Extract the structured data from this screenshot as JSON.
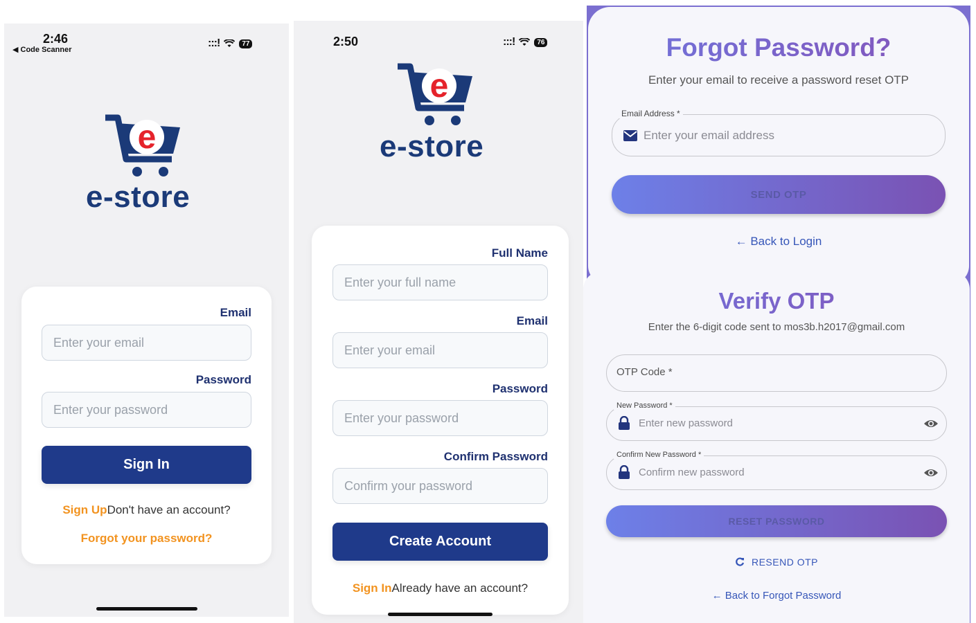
{
  "login_screen": {
    "status": {
      "time": "2:46",
      "back_app": "◀ Code Scanner",
      "signal": ":::!",
      "battery": "77"
    },
    "logo": {
      "letter": "e",
      "text": "e-store"
    },
    "email_label": "Email",
    "email_placeholder": "Enter your email",
    "password_label": "Password",
    "password_placeholder": "Enter your password",
    "sign_in_button": "Sign In",
    "signup_link": "Sign Up",
    "signup_text": "Don't have an account?",
    "forgot_link": "Forgot your password?"
  },
  "register_screen": {
    "status": {
      "time": "2:50",
      "signal": ":::!",
      "battery": "76"
    },
    "logo": {
      "letter": "e",
      "text": "e-store"
    },
    "fullname_label": "Full Name",
    "fullname_placeholder": "Enter your full name",
    "email_label": "Email",
    "email_placeholder": "Enter your email",
    "password_label": "Password",
    "password_placeholder": "Enter your password",
    "confirm_label": "Confirm Password",
    "confirm_placeholder": "Confirm your password",
    "create_button": "Create Account",
    "signin_link": "Sign In",
    "signin_text": "Already have an account?"
  },
  "forgot_panel": {
    "title": "Forgot Password?",
    "subtitle": "Enter your email to receive a password reset OTP",
    "email_legend": "Email Address *",
    "email_placeholder": "Enter your email address",
    "send_button": "SEND OTP",
    "back_link": "← Back to Login"
  },
  "verify_panel": {
    "title": "Verify OTP",
    "subtitle": "Enter the 6-digit code sent to mos3b.h2017@gmail.com",
    "otp_placeholder": "OTP Code *",
    "new_password_legend": "New Password *",
    "new_password_placeholder": "Enter new password",
    "confirm_legend": "Confirm New Password *",
    "confirm_placeholder": "Confirm new password",
    "reset_button": "RESET PASSWORD",
    "resend_link": "RESEND OTP",
    "back_link": "← Back to Forgot Password"
  },
  "colors": {
    "brand_navy": "#1f3a8a",
    "brand_red": "#e5232b",
    "accent_orange": "#f29320",
    "panel_border": "#7b6fd0",
    "gradient_start": "#6d80e8",
    "gradient_end": "#7a52b3"
  }
}
